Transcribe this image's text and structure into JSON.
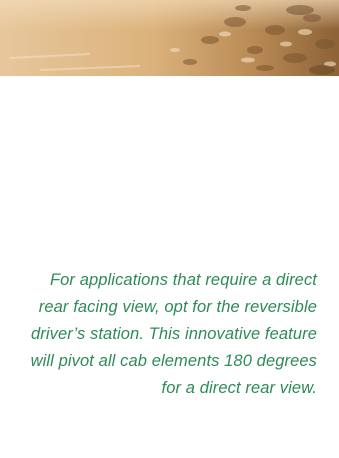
{
  "hero": {
    "icon": "terrain-photo"
  },
  "caption": {
    "text": "For applications that require a direct rear facing view, opt for the reversible driver’s station. This innovative feature will pivot all cab elements 180 degrees for a direct rear view.",
    "color": "#2e8b57"
  }
}
